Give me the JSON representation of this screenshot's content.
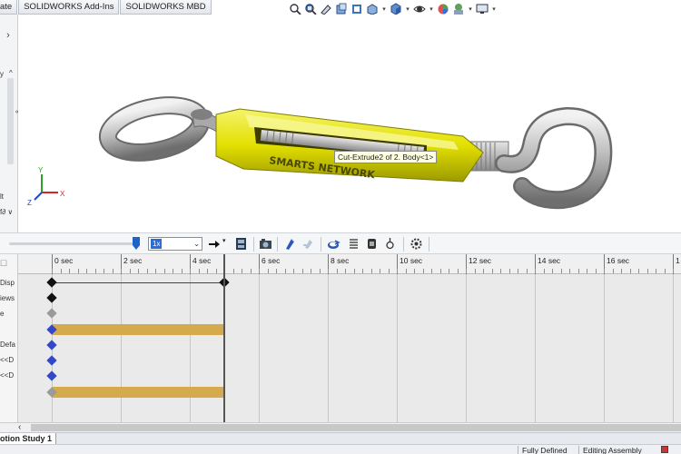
{
  "ribbon_tabs": [
    "ate",
    "SOLIDWORKS Add-Ins",
    "SOLIDWORKS MBD"
  ],
  "left_panel": {
    "collapse_glyph": "›",
    "fragments": [
      "y",
      "^",
      "∞",
      "lt",
      "f∂ ∨"
    ]
  },
  "triad": {
    "x": "X",
    "y": "Y",
    "z": "Z"
  },
  "tooltip": "Cut-Extrude2 of 2. Body<1>",
  "engraving": "SMARTS NETWORK",
  "motion_toolbar": {
    "speed_value": "1x",
    "icons": [
      "arrow-right-icon",
      "filmstrip-icon",
      "camera-icon",
      "autokey-icon",
      "add-key-icon",
      "motor-icon",
      "spring-icon",
      "contact-icon",
      "gravity-icon",
      "study-properties-icon"
    ]
  },
  "timeline": {
    "ticks": [
      "0 sec",
      "2 sec",
      "4 sec",
      "6 sec",
      "8 sec",
      "10 sec",
      "12 sec",
      "14 sec",
      "16 sec",
      "1"
    ],
    "row_labels": [
      "Disp",
      "iews",
      "e",
      "",
      "Defa",
      "<<D",
      "<<D",
      ""
    ]
  },
  "study_tab": "otion Study 1",
  "status_bar": {
    "status": "Fully Defined",
    "mode": "Editing Assembly"
  },
  "colors": {
    "part_yellow": "#e7e500",
    "timeline_bar": "#d4aa4c",
    "key_blue": "#3348c8"
  }
}
